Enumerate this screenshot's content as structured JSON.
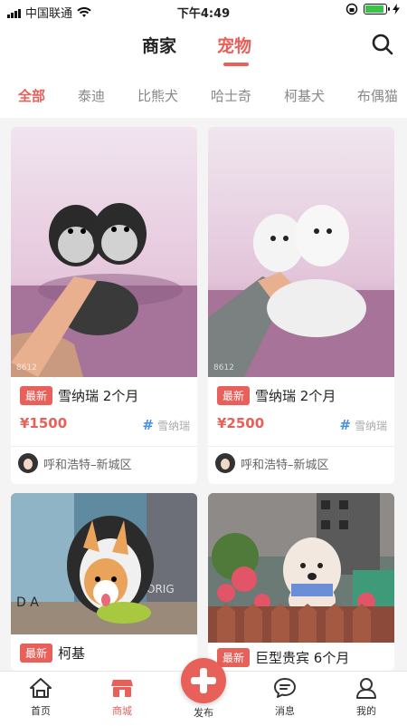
{
  "status": {
    "carrier": "中国联通",
    "time": "下午4:49",
    "battery_percent": 90
  },
  "nav": {
    "tab_merchant": "商家",
    "tab_pets": "宠物",
    "search_icon": "search-icon"
  },
  "categories": [
    "全部",
    "泰迪",
    "比熊犬",
    "哈士奇",
    "柯基犬",
    "布偶猫"
  ],
  "cards": [
    {
      "badge": "最新",
      "title": "雪纳瑞 2个月",
      "price": "¥1500",
      "breed": "雪纳瑞",
      "seller": "呼和浩特–新城区"
    },
    {
      "badge": "最新",
      "title": "雪纳瑞 2个月",
      "price": "¥2500",
      "breed": "雪纳瑞",
      "seller": "呼和浩特–新城区"
    },
    {
      "badge": "最新",
      "title": "柯基"
    },
    {
      "badge": "最新",
      "title": "巨型贵宾 6个月"
    }
  ],
  "tabbar": {
    "home": "首页",
    "mall": "商城",
    "publish": "发布",
    "messages": "消息",
    "mine": "我的"
  },
  "colors": {
    "accent": "#e8605a",
    "hash_blue": "#4a90e2"
  }
}
